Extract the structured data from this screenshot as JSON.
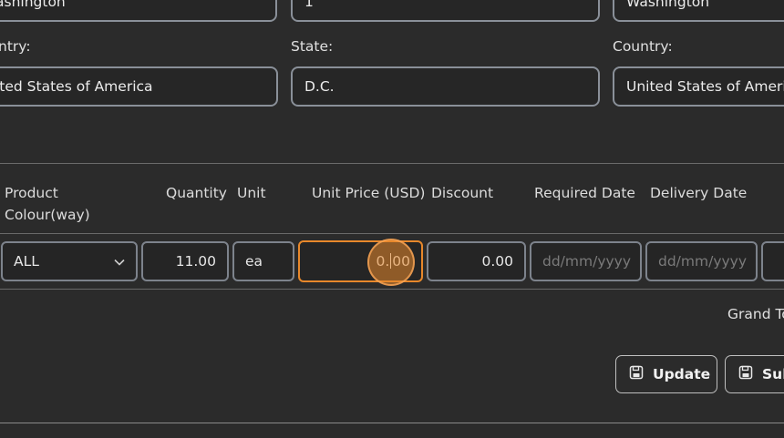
{
  "address": {
    "col1_top_value": "ashington",
    "col2_top_value": "1",
    "col3_top_value": "Washington",
    "country_label_partial": "ntry:",
    "country_value_partial": "ited States of America",
    "state_label": "State:",
    "state_value": "D.C.",
    "country_label": "Country:",
    "country_value": "United States of America"
  },
  "table": {
    "headers": {
      "product_colour": [
        "Product",
        "Colour(way)"
      ],
      "quantity": "Quantity",
      "unit": "Unit",
      "unit_price": "Unit Price (USD)",
      "discount": "Discount",
      "required_date": "Required Date",
      "delivery_date": "Delivery Date"
    },
    "row": {
      "colour": "ALL",
      "quantity": "11.00",
      "unit": "ea",
      "unit_price_before_caret": "0.",
      "unit_price_after_caret": "00",
      "discount": "0.00",
      "required_date_placeholder": "dd/mm/yyyy",
      "delivery_date_placeholder": "dd/mm/yyyy"
    }
  },
  "totals": {
    "grand_total_label_partial": "Grand To"
  },
  "actions": {
    "update_label": "Update",
    "submit_label_partial": "Sub"
  },
  "colors": {
    "accent_focus": "#e8882b",
    "background": "#2b2b2b",
    "field_border": "#8a9099"
  }
}
